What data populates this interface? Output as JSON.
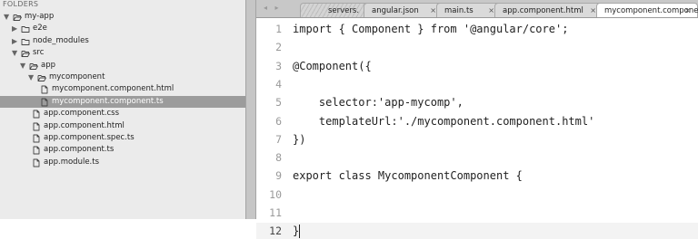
{
  "sidebar": {
    "header": "FOLDERS",
    "items": [
      {
        "label": "my-app",
        "type": "folder-open",
        "depth": 0
      },
      {
        "label": "e2e",
        "type": "folder-closed",
        "depth": 1
      },
      {
        "label": "node_modules",
        "type": "folder-closed",
        "depth": 1
      },
      {
        "label": "src",
        "type": "folder-open",
        "depth": 1
      },
      {
        "label": "app",
        "type": "folder-open",
        "depth": 2
      },
      {
        "label": "mycomponent",
        "type": "folder-open",
        "depth": 3
      },
      {
        "label": "mycomponent.component.html",
        "type": "file",
        "depth": 4
      },
      {
        "label": "mycomponent.component.ts",
        "type": "file",
        "depth": 4,
        "selected": true
      },
      {
        "label": "app.component.css",
        "type": "file",
        "depth": 3
      },
      {
        "label": "app.component.html",
        "type": "file",
        "depth": 3
      },
      {
        "label": "app.component.spec.ts",
        "type": "file",
        "depth": 3
      },
      {
        "label": "app.component.ts",
        "type": "file",
        "depth": 3
      },
      {
        "label": "app.module.ts",
        "type": "file",
        "depth": 3
      }
    ]
  },
  "tabs": [
    {
      "label": "servers.",
      "close": ""
    },
    {
      "label": "angular.json",
      "close": "×"
    },
    {
      "label": "main.ts",
      "close": "×"
    },
    {
      "label": "app.component.html",
      "close": "×"
    },
    {
      "label": "mycomponent.component.ts",
      "close": "×",
      "active": true
    }
  ],
  "nav": {
    "arrows": "◂ ▸"
  },
  "editor": {
    "line_numbers": [
      "1",
      "2",
      "3",
      "4",
      "5",
      "6",
      "7",
      "8",
      "9",
      "10",
      "11",
      "12"
    ],
    "current_line": 12,
    "lines": [
      "import { Component } from '@angular/core';",
      "",
      "@Component({",
      "",
      "    selector:'app-mycomp',",
      "    templateUrl:'./mycomponent.component.html'",
      "})",
      "",
      "export class MycomponentComponent {",
      "",
      "",
      "}"
    ]
  },
  "colors": {
    "sidebar_bg": "#ebebeb",
    "selected_row": "#9c9c9c",
    "tabbar_bg": "#c8c8c8",
    "editor_bg": "#ffffff"
  }
}
